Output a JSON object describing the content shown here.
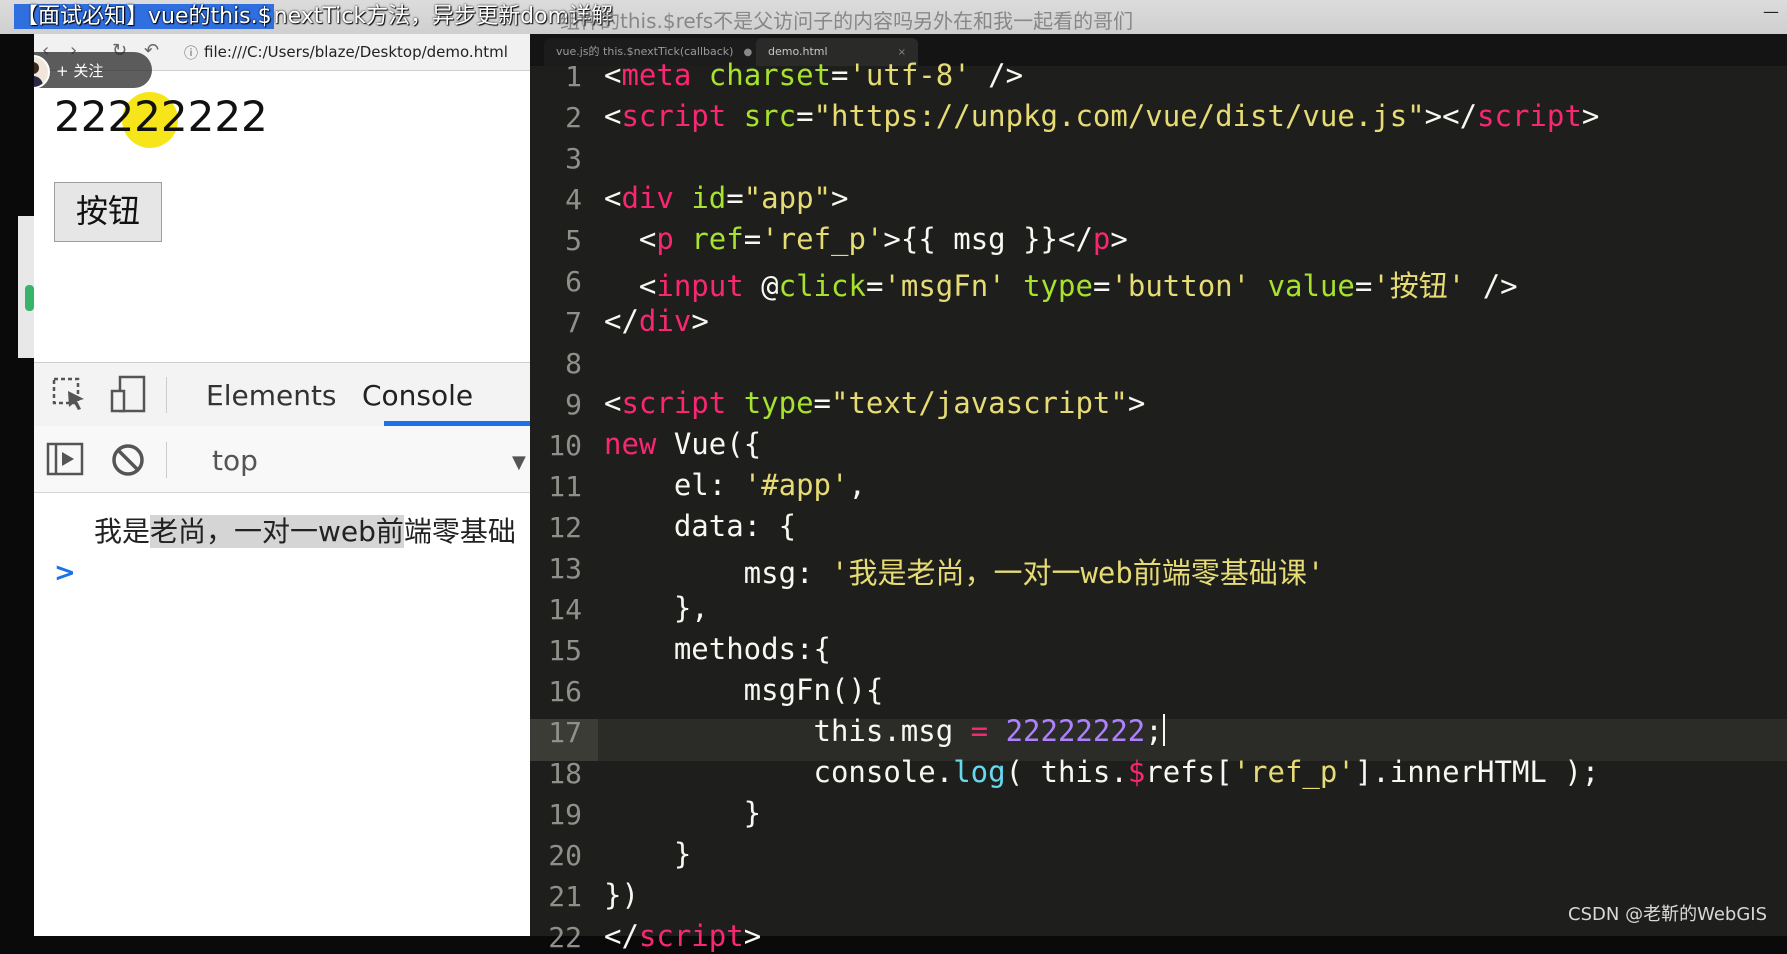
{
  "video": {
    "title_highlight": "【面试必知】vue的this.$",
    "title_rest": "nextTick方法，异步更新dom详解",
    "ghost_title": "组件的this.$refs不是父访问子的内容吗另外在和我一起看的哥们"
  },
  "browser": {
    "url": "file:///C:/Users/blaze/Desktop/demo.html",
    "follow_label": "+ 关注",
    "page_message": "22222222",
    "page_button": "按钮"
  },
  "devtools": {
    "tab_elements": "Elements",
    "tab_console": "Console",
    "context": "top",
    "console_log_pre": "我是",
    "console_log_sel": "老尚，一对一web前",
    "console_log_post": "端零基础",
    "prompt": ">"
  },
  "editor": {
    "tab1": "vue.js的 this.$nextTick(callback)",
    "tab2": "demo.html",
    "line_numbers": [
      "1",
      "2",
      "3",
      "4",
      "5",
      "6",
      "7",
      "8",
      "9",
      "10",
      "11",
      "12",
      "13",
      "14",
      "15",
      "16",
      "17",
      "18",
      "19",
      "20",
      "21",
      "22"
    ],
    "code": {
      "l1": {
        "a": "<",
        "b": "meta",
        "c": " ",
        "d": "charset",
        "e": "=",
        "f": "'utf-8'",
        "g": " />"
      },
      "l2": {
        "a": "<",
        "b": "script",
        "c": " ",
        "d": "src",
        "e": "=",
        "f": "\"https://unpkg.com/vue/dist/vue.js\"",
        "g": "></",
        "h": "script",
        "i": ">"
      },
      "l4": {
        "a": "<",
        "b": "div",
        "c": " ",
        "d": "id",
        "e": "=",
        "f": "\"app\"",
        "g": ">"
      },
      "l5": {
        "a": "  <",
        "b": "p",
        "c": " ",
        "d": "ref",
        "e": "=",
        "f": "'ref_p'",
        "g": ">{{ msg }}</",
        "h": "p",
        "i": ">"
      },
      "l6": {
        "a": "  <",
        "b": "input",
        "c": " @",
        "d": "click",
        "e": "=",
        "f": "'msgFn'",
        "g": " ",
        "h": "type",
        "i": "=",
        "j": "'button'",
        "k": " ",
        "l": "value",
        "m": "=",
        "n": "'按钮'",
        "o": " />"
      },
      "l7": {
        "a": "</",
        "b": "div",
        "c": ">"
      },
      "l9": {
        "a": "<",
        "b": "script",
        "c": " ",
        "d": "type",
        "e": "=",
        "f": "\"text/javascript\"",
        "g": ">"
      },
      "l10": {
        "a": "new",
        "b": " Vue({"
      },
      "l11": {
        "a": "    el: ",
        "b": "'#app'",
        "c": ","
      },
      "l12": {
        "a": "    data: {"
      },
      "l13": {
        "a": "        msg: ",
        "b": "'我是老尚，一对一web前端零基础课'"
      },
      "l14": {
        "a": "    },"
      },
      "l15": {
        "a": "    methods:{"
      },
      "l16": {
        "a": "        msgFn(){"
      },
      "l17": {
        "a": "            this.msg ",
        "b": "=",
        "c": " ",
        "d": "22222222",
        "e": ";"
      },
      "l18": {
        "a": "            console.",
        "b": "log",
        "c": "( this.",
        "d": "$",
        "e": "refs[",
        "f": "'ref_p'",
        "g": "].innerHTML );"
      },
      "l19": {
        "a": "        }"
      },
      "l20": {
        "a": "    }"
      },
      "l21": {
        "a": "})"
      },
      "l22": {
        "a": "</",
        "b": "script",
        "c": ">"
      }
    }
  },
  "watermark": "CSDN @老靳的WebGIS"
}
